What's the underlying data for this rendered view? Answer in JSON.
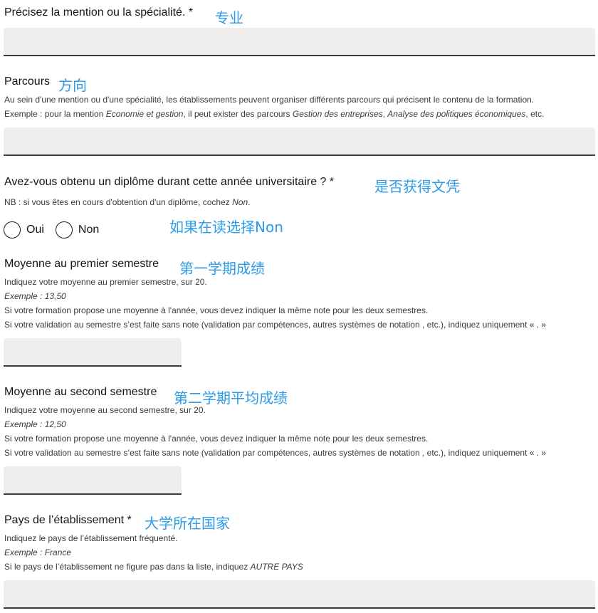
{
  "fields": {
    "mention": {
      "label": "Précisez la mention ou la spécialité. *",
      "annotation": "专业",
      "value": ""
    },
    "parcours": {
      "label": "Parcours",
      "annotation": "方向",
      "hint_line1": "Au sein d'une mention ou d'une spécialité, les établissements peuvent organiser différents parcours qui précisent le contenu de la formation.",
      "hint_line2_prefix": "Exemple : pour la mention ",
      "hint_line2_italic1": "Economie et gestion",
      "hint_line2_mid": ", il peut exister des parcours ",
      "hint_line2_italic2": "Gestion des entreprises",
      "hint_line2_sep": ", ",
      "hint_line2_italic3": "Analyse des politiques économiques",
      "hint_line2_suffix": ", etc.",
      "value": ""
    },
    "diplome": {
      "label": "Avez-vous obtenu un diplôme durant cette année universitaire ? *",
      "annotation": "是否获得文凭",
      "hint_prefix": "NB : si vous êtes en cours d'obtention d'un diplôme, cochez ",
      "hint_italic": "Non",
      "hint_suffix": ".",
      "options": [
        {
          "label": "Oui",
          "selected": false
        },
        {
          "label": "Non",
          "selected": false
        }
      ],
      "options_annotation": "如果在读选择Non"
    },
    "moyenne_s1": {
      "label": "Moyenne au premier semestre",
      "annotation": "第一学期成绩",
      "hint_line1": "Indiquez votre moyenne au premier semestre, sur 20.",
      "hint_example": "Exemple : 13,50",
      "hint_line3": "Si votre formation propose une moyenne à l'année, vous devez indiquer la même note pour les deux semestres.",
      "hint_line4": "Si votre validation au semestre s’est faite sans note (validation par compétences, autres systèmes de notation , etc.), indiquez uniquement « . »",
      "value": ""
    },
    "moyenne_s2": {
      "label": "Moyenne au second semestre",
      "annotation": "第二学期平均成绩",
      "hint_line1": "Indiquez votre moyenne au second semestre, sur 20.",
      "hint_example": "Exemple : 12,50",
      "hint_line3": "Si votre formation propose une moyenne à l'année, vous devez indiquer la même note pour les deux semestres.",
      "hint_line4": "Si votre validation au semestre s’est faite sans note (validation par compétences, autres systèmes de notation , etc.), indiquez uniquement « . »",
      "value": ""
    },
    "pays": {
      "label": "Pays de l’établissement *",
      "annotation": "大学所在国家",
      "hint_line1": "Indiquez le pays de l’établissement fréquenté.",
      "hint_example": "Exemple : France",
      "hint_line3_prefix": "Si le pays de l’établissement ne figure pas dans la liste, indiquez ",
      "hint_line3_italic": "AUTRE PAYS",
      "value": ""
    }
  },
  "colors": {
    "annotation": "#2c9be8",
    "field_bg": "#eeeeee",
    "field_border": "#3a3a3a"
  }
}
